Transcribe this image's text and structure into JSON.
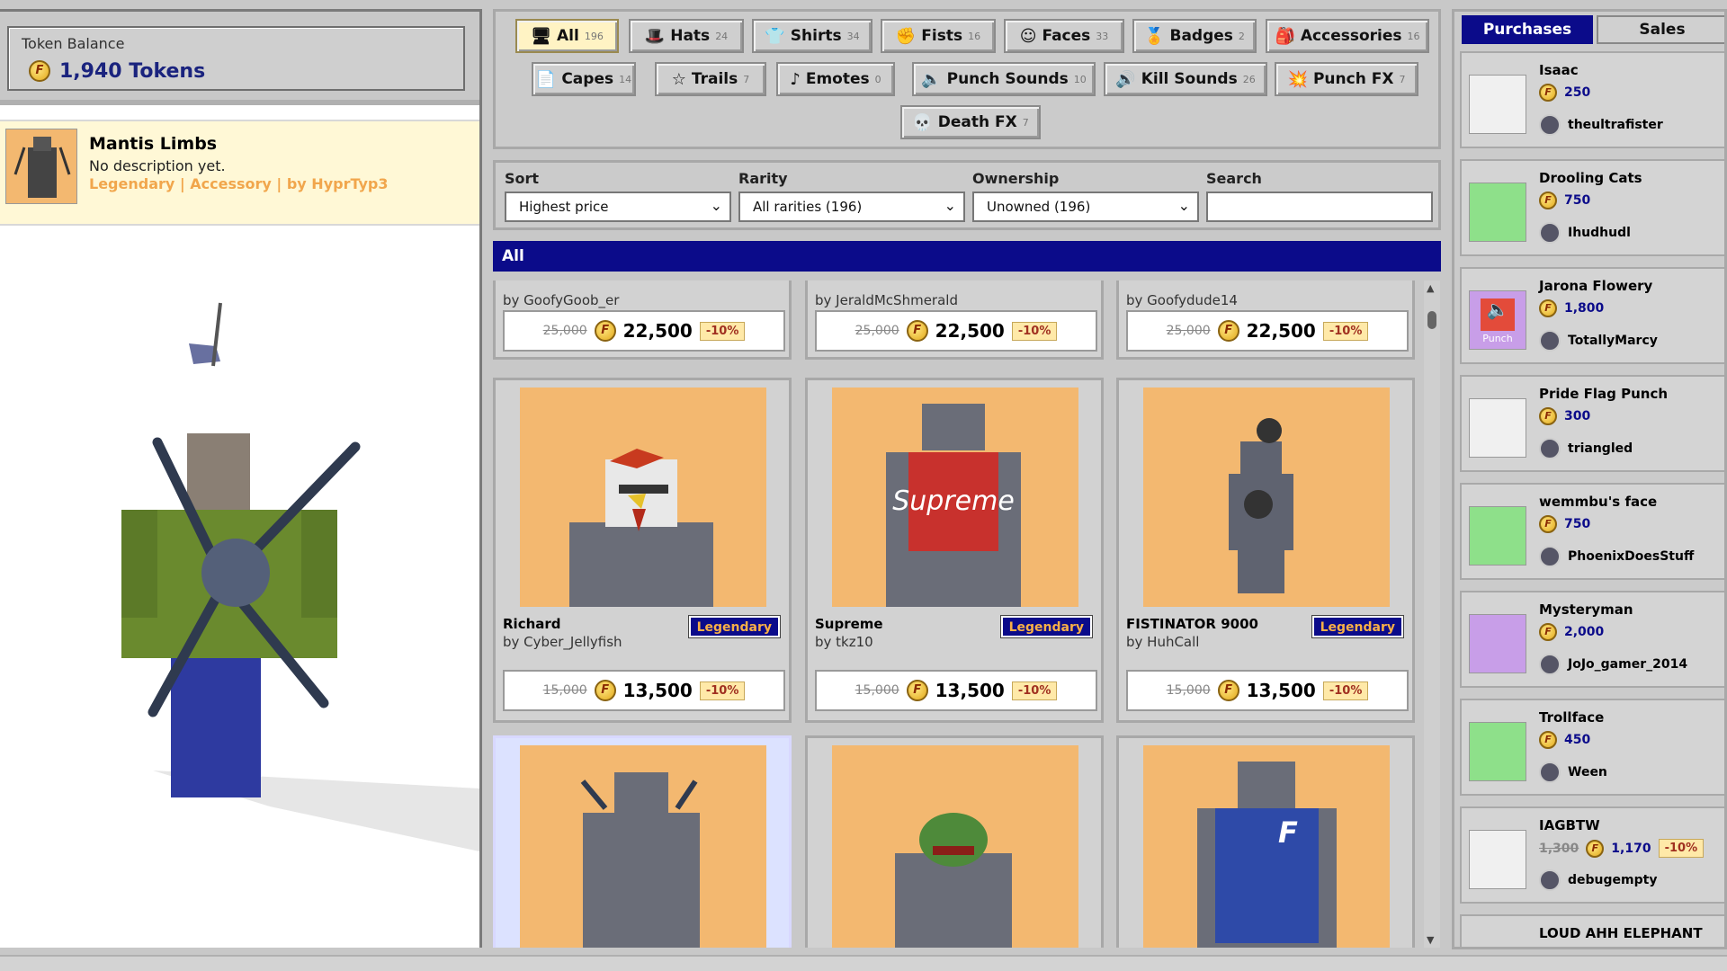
{
  "balance": {
    "label": "Token Balance",
    "value": "1,940 Tokens",
    "coin_icon": "token-coin-icon"
  },
  "selected_item": {
    "name": "Mantis Limbs",
    "description": "No description yet.",
    "meta": "Legendary | Accessory | by HyprTyp3"
  },
  "tabs": [
    {
      "label": "All",
      "count": "196",
      "icon": "monitor-icon"
    },
    {
      "label": "Hats",
      "count": "24",
      "icon": "hat-icon"
    },
    {
      "label": "Shirts",
      "count": "34",
      "icon": "shirt-icon"
    },
    {
      "label": "Fists",
      "count": "16",
      "icon": "fist-icon"
    },
    {
      "label": "Faces",
      "count": "33",
      "icon": "face-icon"
    },
    {
      "label": "Badges",
      "count": "2",
      "icon": "badge-icon"
    },
    {
      "label": "Accessories",
      "count": "16",
      "icon": "accessory-icon"
    },
    {
      "label": "Capes",
      "count": "14",
      "icon": "cape-icon"
    },
    {
      "label": "Trails",
      "count": "7",
      "icon": "star-icon"
    },
    {
      "label": "Emotes",
      "count": "0",
      "icon": "emote-icon"
    },
    {
      "label": "Punch Sounds",
      "count": "10",
      "icon": "speaker-icon"
    },
    {
      "label": "Kill Sounds",
      "count": "26",
      "icon": "kill-sound-icon"
    },
    {
      "label": "Punch FX",
      "count": "7",
      "icon": "punch-fx-icon"
    },
    {
      "label": "Death FX",
      "count": "7",
      "icon": "death-fx-icon"
    }
  ],
  "filters": {
    "sort_label": "Sort",
    "sort_value": "Highest price",
    "rarity_label": "Rarity",
    "rarity_value": "All rarities (196)",
    "ownership_label": "Ownership",
    "ownership_value": "Unowned (196)",
    "search_label": "Search",
    "search_value": ""
  },
  "section_title": "All",
  "top_row": [
    {
      "by": "by GoofyGoob_er",
      "old": "25,000",
      "now": "22,500",
      "discount": "-10%"
    },
    {
      "by": "by JeraldMcShmerald",
      "old": "25,000",
      "now": "22,500",
      "discount": "-10%"
    },
    {
      "by": "by Goofydude14",
      "old": "25,000",
      "now": "22,500",
      "discount": "-10%"
    }
  ],
  "items": [
    {
      "name": "Richard",
      "by": "by Cyber_Jellyfish",
      "rarity": "Legendary",
      "old": "15,000",
      "now": "13,500",
      "discount": "-10%"
    },
    {
      "name": "Supreme",
      "by": "by tkz10",
      "rarity": "Legendary",
      "old": "15,000",
      "now": "13,500",
      "discount": "-10%",
      "shirt_text": "Supreme"
    },
    {
      "name": "FISTINATOR 9000",
      "by": "by HuhCall",
      "rarity": "Legendary",
      "old": "15,000",
      "now": "13,500",
      "discount": "-10%"
    }
  ],
  "right_tabs": {
    "purchases": "Purchases",
    "sales": "Sales"
  },
  "purchases": [
    {
      "name": "Isaac",
      "price": "250",
      "user": "theultrafister",
      "thumb_color": "#f0f0f0"
    },
    {
      "name": "Drooling Cats",
      "price": "750",
      "user": "Ihudhudl",
      "thumb_color": "#8ee08a"
    },
    {
      "name": "Jarona Flowery",
      "price": "1,800",
      "user": "TotallyMarcy",
      "thumb_color": "#c89ee8",
      "thumb_label": "Punch"
    },
    {
      "name": "Pride Flag Punch",
      "price": "300",
      "user": "triangled",
      "thumb_color": "#f0f0f0"
    },
    {
      "name": "wemmbu's face",
      "price": "750",
      "user": "PhoenixDoesStuff",
      "thumb_color": "#8ee08a"
    },
    {
      "name": "Mysteryman",
      "price": "2,000",
      "user": "JoJo_gamer_2014",
      "thumb_color": "#c89ee8"
    },
    {
      "name": "Trollface",
      "price": "450",
      "user": "Ween",
      "thumb_color": "#8ee08a"
    },
    {
      "name": "IAGBTW",
      "old": "1,300",
      "price": "1,170",
      "discount": "-10%",
      "user": "debugempty",
      "thumb_color": "#f0f0f0"
    },
    {
      "name": "LOUD AHH ELEPHANT"
    }
  ]
}
